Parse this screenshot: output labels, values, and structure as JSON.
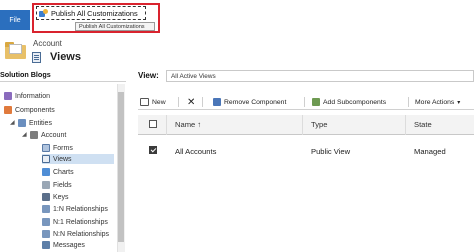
{
  "ribbon": {
    "file_label": "File",
    "publish_label": "Publish All Customizations",
    "publish_tooltip": "Publish All Customizations"
  },
  "entity": {
    "type_label": "Account",
    "name": "Views"
  },
  "tree": {
    "title": "Solution Blogs",
    "items": [
      {
        "label": "Information",
        "icon": "information-icon"
      },
      {
        "label": "Components",
        "icon": "components-icon"
      },
      {
        "label": "Entities",
        "icon": "entities-icon"
      },
      {
        "label": "Account",
        "icon": "account-entity-icon"
      },
      {
        "label": "Forms",
        "icon": "forms-icon"
      },
      {
        "label": "Views",
        "icon": "views-icon"
      },
      {
        "label": "Charts",
        "icon": "charts-icon"
      },
      {
        "label": "Fields",
        "icon": "fields-icon"
      },
      {
        "label": "Keys",
        "icon": "keys-icon"
      },
      {
        "label": "1:N Relationships",
        "icon": "relationship-icon"
      },
      {
        "label": "N:1 Relationships",
        "icon": "relationship-icon"
      },
      {
        "label": "N:N Relationships",
        "icon": "relationship-icon"
      },
      {
        "label": "Messages",
        "icon": "messages-icon"
      }
    ]
  },
  "view_selector": {
    "label": "View:",
    "value": "All Active Views"
  },
  "commands": {
    "new": "New",
    "remove_component": "Remove Component",
    "add_subcomponents": "Add Subcomponents",
    "more_actions": "More Actions"
  },
  "grid": {
    "columns": [
      "Name ↑",
      "Type",
      "State"
    ],
    "rows": [
      {
        "name": "All Accounts",
        "type": "Public View",
        "state": "Managed",
        "checked": true
      }
    ]
  },
  "colors": {
    "file_button": "#2b6fbe",
    "highlight_outline": "#d9232e",
    "selected_node": "#cfe0f2"
  }
}
